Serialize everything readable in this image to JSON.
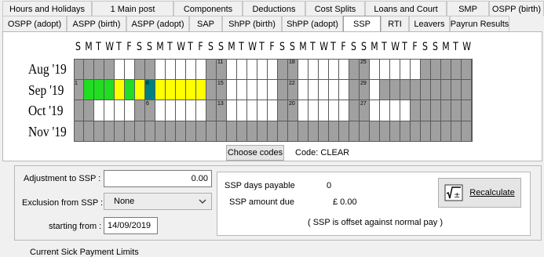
{
  "tabs_row1": [
    "Hours and Holidays",
    "1 Main post",
    "Components",
    "Deductions",
    "Cost Splits",
    "Loans and Court",
    "SMP",
    "OSPP (birth)"
  ],
  "tabs_row2": [
    "OSPP (adopt)",
    "ASPP (birth)",
    "ASPP (adopt)",
    "SAP",
    "ShPP (birth)",
    "ShPP (adopt)",
    "SSP",
    "RTI",
    "Leavers",
    "Payrun Results"
  ],
  "active_tab": "SSP",
  "calendar": {
    "day_headers": [
      "S",
      "M",
      "T",
      "W",
      "T",
      "F",
      "S",
      "S",
      "M",
      "T",
      "W",
      "T",
      "F",
      "S",
      "S",
      "M",
      "T",
      "W",
      "T",
      "F",
      "S",
      "S",
      "M",
      "T",
      "W",
      "T",
      "F",
      "S",
      "S",
      "M",
      "T",
      "W",
      "T",
      "F",
      "S",
      "S",
      "M",
      "T",
      "W"
    ],
    "months": [
      {
        "label": "Aug '19",
        "start": 4,
        "days": 31
      },
      {
        "label": "Sep '19",
        "start": 0,
        "days": 30
      },
      {
        "label": "Oct '19",
        "start": 2,
        "days": 31
      },
      {
        "label": "Nov '19",
        "start": 5,
        "days": 30
      }
    ],
    "colors": {
      "grey": "#a0a0a0",
      "white": "#ffffff",
      "green": "#22dd22",
      "yellow": "#ffff00",
      "teal": "#008080"
    },
    "sep_day_colors": {
      "2": "green",
      "3": "green",
      "4": "green",
      "5": "yellow",
      "6": "green",
      "7": "yellow",
      "8": "teal",
      "9": "yellow",
      "10": "yellow",
      "11": "yellow",
      "12": "yellow",
      "13": "yellow"
    },
    "month_start_days": {
      "Oct '19": [
        6,
        13,
        20,
        27
      ]
    },
    "numbered_days": {
      "Aug '19": [
        "11",
        "18",
        "25"
      ],
      "Sep '19": [
        "1",
        "8",
        "15",
        "22",
        "29"
      ],
      "Oct '19": [
        "6",
        "13",
        "20",
        "27"
      ]
    }
  },
  "choose_codes_label": "Choose codes",
  "code_label": "Code:",
  "code_value": "CLEAR",
  "adjustment_label": "Adjustment to SSP :",
  "adjustment_value": "0.00",
  "exclusion_label": "Exclusion from SSP :",
  "exclusion_value": "None",
  "starting_from_label": "starting from :",
  "starting_from_value": "14/09/2019",
  "ssp_days_label": "SSP days payable",
  "ssp_days_value": "0",
  "ssp_amount_label": "SSP amount due",
  "ssp_amount_value": "£ 0.00",
  "offset_note": "( SSP is offset against normal pay )",
  "recalculate_label": "Recalculate",
  "bottom_text": "Current Sick Payment Limits"
}
